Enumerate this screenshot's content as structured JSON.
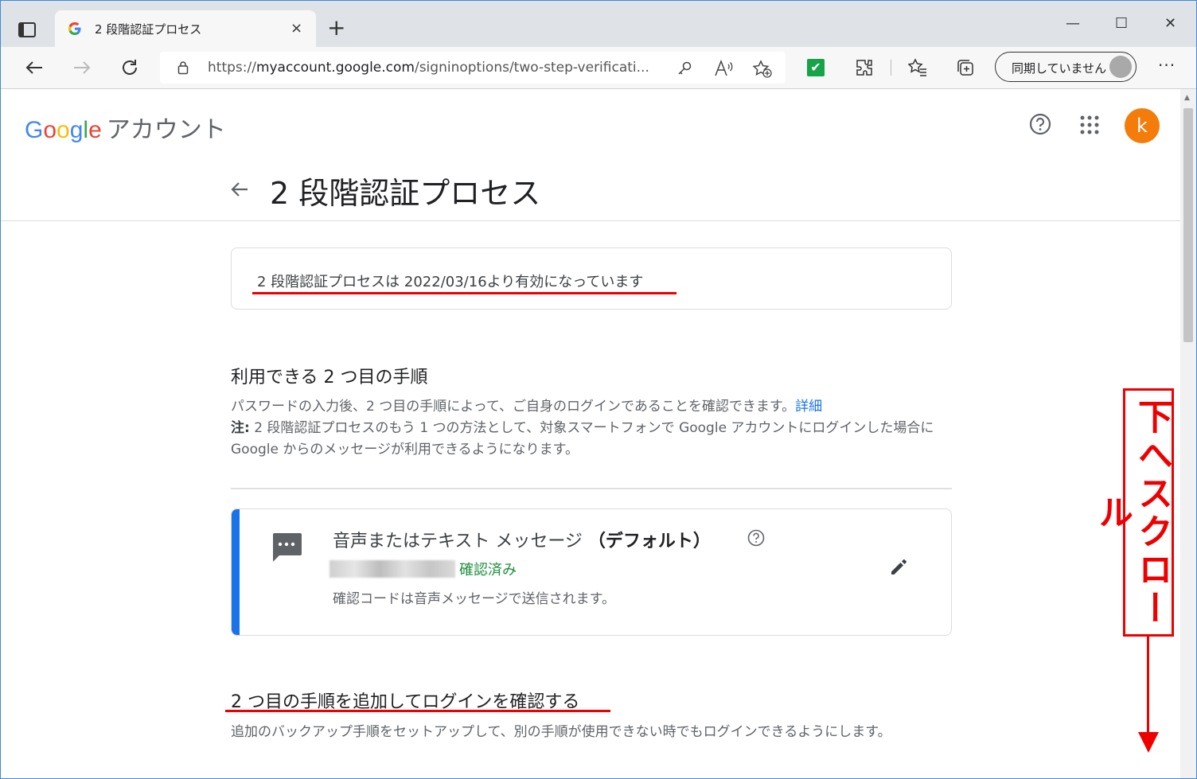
{
  "browser": {
    "tab_title": "2 段階認証プロセス",
    "tab_close": "×",
    "new_tab": "+",
    "url_prefix": "https://",
    "url_domain": "myaccount.google.com",
    "url_path": "/signinoptions/two-step-verificati...",
    "sync_label": "同期していません",
    "more": "···",
    "window_controls": [
      "—",
      "☐",
      "✕"
    ]
  },
  "header": {
    "logo_google": [
      "G",
      "o",
      "o",
      "g",
      "l",
      "e"
    ],
    "logo_sub": "アカウント",
    "avatar_letter": "k"
  },
  "page": {
    "title": "2 段階認証プロセス",
    "status_text": "2 段階認証プロセスは 2022/03/16より有効になっています",
    "section1_title": "利用できる 2 つ目の手順",
    "section1_desc_main": "パスワードの入力後、2 つ目の手順によって、ご自身のログインであることを確認できます。",
    "section1_link": "詳細",
    "section1_note_label": "注:",
    "section1_note": " 2 段階認証プロセスのもう 1 つの方法として、対象スマートフォンで Google アカウントにログインした場合に Google からのメッセージが利用できるようになります。",
    "method_title": "音声またはテキスト メッセージ",
    "method_default": "（デフォルト）",
    "method_verified": "確認済み",
    "method_note": "確認コードは音声メッセージで送信されます。",
    "section2_title": "2 つ目の手順を追加してログインを確認する",
    "section2_desc": "追加のバックアップ手順をセットアップして、別の手順が使用できない時でもログインできるようにします。"
  },
  "annotation": {
    "text": "下へスクロール",
    "color": "#ee0000"
  },
  "colors": {
    "accent_blue": "#1a73e8",
    "verified_green": "#1e8e3e",
    "avatar_orange": "#f37c0a"
  }
}
